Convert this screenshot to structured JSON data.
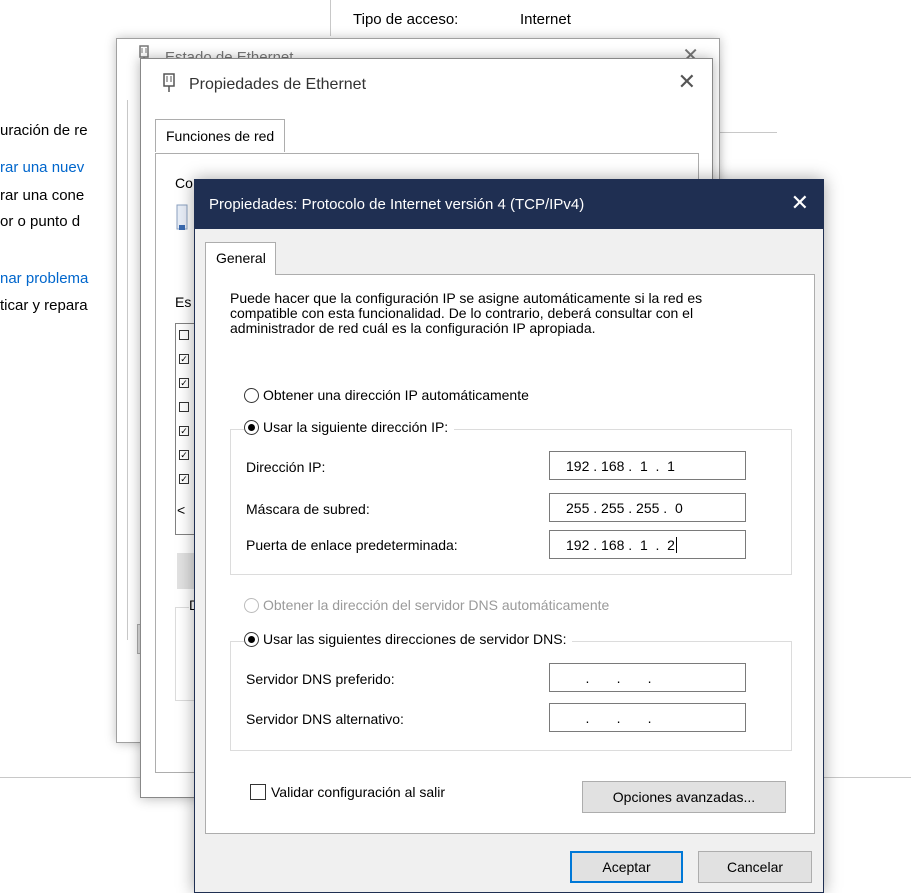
{
  "background": {
    "access_type_label": "Tipo de acceso:",
    "access_type_value": "Internet",
    "left_fragments": [
      {
        "text": "uración de re",
        "link": false
      },
      {
        "text": "rar una nuev",
        "link": true
      },
      {
        "text": "rar una cone",
        "link": false
      },
      {
        "text": "or o punto d",
        "link": false
      },
      {
        "text": "nar problema",
        "link": true
      },
      {
        "text": "ticar y repara",
        "link": false
      }
    ]
  },
  "estado_window": {
    "title": "Estado de Ethernet",
    "close_glyph": "✕"
  },
  "ethernet_props": {
    "title": "Propiedades de Ethernet",
    "close_glyph": "✕",
    "tab_label": "Funciones de red",
    "fragment_connect": "Co",
    "fragment_items": "Es",
    "fragment_desc": "D",
    "fragment_arrow": "<"
  },
  "ipv4_dialog": {
    "title": "Propiedades: Protocolo de Internet versión 4 (TCP/IPv4)",
    "close_glyph": "✕",
    "tab_general": "General",
    "description": "Puede hacer que la configuración IP se asigne automáticamente si la red es compatible con esta funcionalidad. De lo contrario, deberá consultar con el administrador de red cuál es la configuración IP apropiada.",
    "ip_auto_label": "Obtener una dirección IP automáticamente",
    "ip_manual_label": "Usar la siguiente dirección IP:",
    "ip_address_label": "Dirección IP:",
    "ip_address_value": "192 . 168 .  1  .  1",
    "subnet_label": "Máscara de subred:",
    "subnet_value": "255 . 255 . 255 .  0",
    "gateway_label": "Puerta de enlace predeterminada:",
    "gateway_value": "192 . 168 .  1  .  2",
    "dns_auto_label": "Obtener la dirección del servidor DNS automáticamente",
    "dns_manual_label": "Usar las siguientes direcciones de servidor DNS:",
    "dns_preferred_label": "Servidor DNS preferido:",
    "dns_preferred_value": "     .       .       .",
    "dns_alternate_label": "Servidor DNS alternativo:",
    "dns_alternate_value": "     .       .       .",
    "validate_label": "Validar configuración al salir",
    "advanced_button": "Opciones avanzadas...",
    "ok_button": "Aceptar",
    "cancel_button": "Cancelar",
    "ip_mode": "manual",
    "dns_mode": "manual",
    "validate_checked": false
  }
}
